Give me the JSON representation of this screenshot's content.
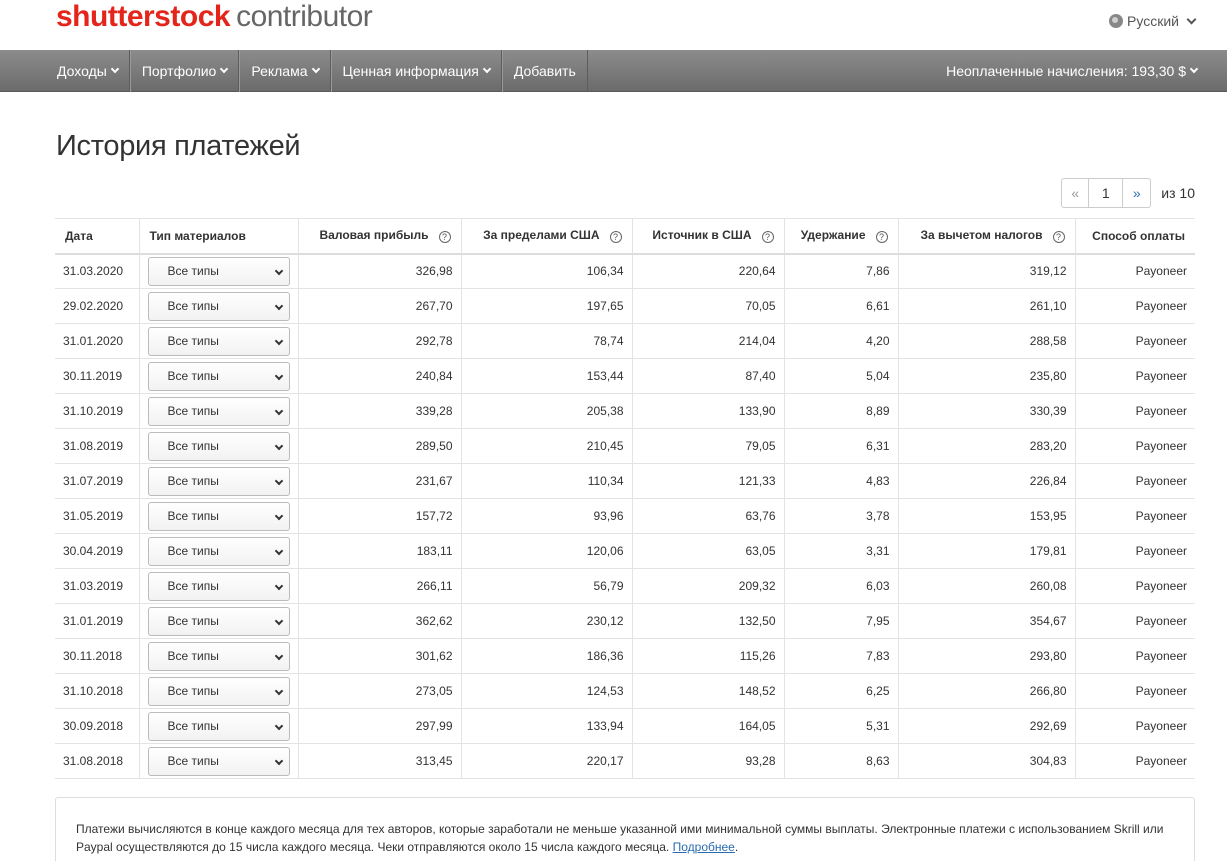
{
  "header": {
    "brand_part1": "shutterst",
    "brand_o": "o",
    "brand_part2": "ck",
    "brand_sub": "contributor",
    "language": "Русский"
  },
  "nav": {
    "items": [
      {
        "label": "Доходы",
        "dropdown": true
      },
      {
        "label": "Портфолио",
        "dropdown": true
      },
      {
        "label": "Реклама",
        "dropdown": true
      },
      {
        "label": "Ценная информация",
        "dropdown": true
      },
      {
        "label": "Добавить",
        "dropdown": false
      }
    ],
    "unpaid": "Неоплаченные начисления: 193,30 $"
  },
  "page": {
    "title": "История платежей"
  },
  "pagination": {
    "prev": "«",
    "current": "1",
    "next": "»",
    "of": "из 10"
  },
  "table": {
    "headers": [
      "Дата",
      "Тип материалов",
      "Валовая прибыль",
      "За пределами США",
      "Источник в США",
      "Удержание",
      "За вычетом налогов",
      "Способ оплаты"
    ],
    "rows": [
      [
        "31.03.2020",
        "Все типы",
        "326,98",
        "106,34",
        "220,64",
        "7,86",
        "319,12",
        "Payoneer"
      ],
      [
        "29.02.2020",
        "Все типы",
        "267,70",
        "197,65",
        "70,05",
        "6,61",
        "261,10",
        "Payoneer"
      ],
      [
        "31.01.2020",
        "Все типы",
        "292,78",
        "78,74",
        "214,04",
        "4,20",
        "288,58",
        "Payoneer"
      ],
      [
        "30.11.2019",
        "Все типы",
        "240,84",
        "153,44",
        "87,40",
        "5,04",
        "235,80",
        "Payoneer"
      ],
      [
        "31.10.2019",
        "Все типы",
        "339,28",
        "205,38",
        "133,90",
        "8,89",
        "330,39",
        "Payoneer"
      ],
      [
        "31.08.2019",
        "Все типы",
        "289,50",
        "210,45",
        "79,05",
        "6,31",
        "283,20",
        "Payoneer"
      ],
      [
        "31.07.2019",
        "Все типы",
        "231,67",
        "110,34",
        "121,33",
        "4,83",
        "226,84",
        "Payoneer"
      ],
      [
        "31.05.2019",
        "Все типы",
        "157,72",
        "93,96",
        "63,76",
        "3,78",
        "153,95",
        "Payoneer"
      ],
      [
        "30.04.2019",
        "Все типы",
        "183,11",
        "120,06",
        "63,05",
        "3,31",
        "179,81",
        "Payoneer"
      ],
      [
        "31.03.2019",
        "Все типы",
        "266,11",
        "56,79",
        "209,32",
        "6,03",
        "260,08",
        "Payoneer"
      ],
      [
        "31.01.2019",
        "Все типы",
        "362,62",
        "230,12",
        "132,50",
        "7,95",
        "354,67",
        "Payoneer"
      ],
      [
        "30.11.2018",
        "Все типы",
        "301,62",
        "186,36",
        "115,26",
        "7,83",
        "293,80",
        "Payoneer"
      ],
      [
        "31.10.2018",
        "Все типы",
        "273,05",
        "124,53",
        "148,52",
        "6,25",
        "266,80",
        "Payoneer"
      ],
      [
        "30.09.2018",
        "Все типы",
        "297,99",
        "133,94",
        "164,05",
        "5,31",
        "292,69",
        "Payoneer"
      ],
      [
        "31.08.2018",
        "Все типы",
        "313,45",
        "220,17",
        "93,28",
        "8,63",
        "304,83",
        "Payoneer"
      ]
    ]
  },
  "note": {
    "text": "Платежи вычисляются в конце каждого месяца для тех авторов, которые заработали не меньше указанной ими минимальной суммы выплаты. Электронные платежи с использованием Skrill или Paypal осуществляются до 15 числа каждого месяца. Чеки отправляются около 15 числа каждого месяца.",
    "link": "Подробнее",
    "end": "."
  },
  "icons": {
    "language": "globe-icon",
    "dropdown": "chevron-down-icon",
    "help": "help-circle-icon"
  },
  "colors": {
    "brand": "#e3251b",
    "link": "#2b6cb0",
    "navbar": "#7a7a7a"
  }
}
